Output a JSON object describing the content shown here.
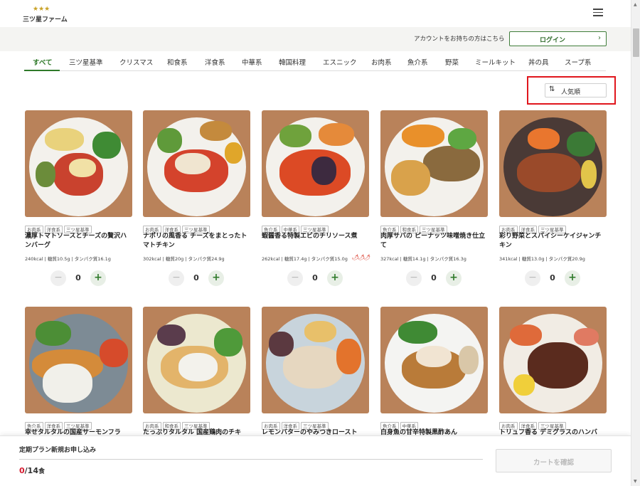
{
  "header": {
    "brand_stars": "★★★",
    "brand_name": "三ツ星ファーム",
    "account_prompt": "アカウントをお持ちの方はこちら",
    "login_label": "ログイン",
    "login_chevron": "›"
  },
  "tabs": [
    {
      "label": "すべて"
    },
    {
      "label": "三ツ星基準"
    },
    {
      "label": "クリスマス"
    },
    {
      "label": "和食系"
    },
    {
      "label": "洋食系"
    },
    {
      "label": "中華系"
    },
    {
      "label": "韓国料理"
    },
    {
      "label": "エスニック"
    },
    {
      "label": "お肉系"
    },
    {
      "label": "魚介系"
    },
    {
      "label": "野菜"
    },
    {
      "label": "ミールキット"
    },
    {
      "label": "丼の具"
    },
    {
      "label": "スープ系"
    }
  ],
  "sort": {
    "icon": "⇅",
    "label": "人気順"
  },
  "products": [
    {
      "tags": [
        "お肉系",
        "洋食系",
        "三ツ星基準"
      ],
      "title": "濃厚トマトソースとチーズの贅沢ハンバーグ",
      "nutrition": "240kcal | 糖質10.5g | タンパク質16.1g",
      "qty": "0",
      "spicy": ""
    },
    {
      "tags": [
        "お肉系",
        "洋食系",
        "三ツ星基準"
      ],
      "title": "ナポリの風香る チーズをまとったトマトチキン",
      "nutrition": "302kcal | 糖質20g | タンパク質24.9g",
      "qty": "0",
      "spicy": ""
    },
    {
      "tags": [
        "魚介系",
        "中華系",
        "三ツ星基準"
      ],
      "title": "蝦醤香る特製エビのチリソース煮",
      "nutrition": "262kcal | 糖質17.4g | タンパク質15.0g",
      "qty": "0",
      "spicy": "🌶🌶🌶"
    },
    {
      "tags": [
        "魚介系",
        "和食系",
        "三ツ星基準"
      ],
      "title": "肉厚サバの ピーナッツ味噌焼き仕立て",
      "nutrition": "327kcal | 糖質14.1g | タンパク質16.3g",
      "qty": "0",
      "spicy": ""
    },
    {
      "tags": [
        "お肉系",
        "洋食系",
        "三ツ星基準"
      ],
      "title": "彩り野菜とスパイシーケイジャンチキン",
      "nutrition": "341kcal | 糖質13.0g | タンパク質20.9g",
      "qty": "0",
      "spicy": ""
    },
    {
      "tags": [
        "魚介系",
        "洋食系",
        "三ツ星基準"
      ],
      "title": "幸せタルタルの国産サーモンフラ",
      "nutrition": "",
      "qty": "",
      "spicy": ""
    },
    {
      "tags": [
        "お肉系",
        "和食系",
        "三ツ星基準"
      ],
      "title": "たっぷりタルタル 国産鶏肉のチキ",
      "nutrition": "",
      "qty": "",
      "spicy": ""
    },
    {
      "tags": [
        "お肉系",
        "洋食系",
        "三ツ星基準"
      ],
      "title": "レモンバターのやみつきロースト",
      "nutrition": "",
      "qty": "",
      "spicy": ""
    },
    {
      "tags": [
        "魚介系",
        "中華系"
      ],
      "title": "白身魚の甘辛特製黒酢あん",
      "nutrition": "",
      "qty": "",
      "spicy": ""
    },
    {
      "tags": [
        "お肉系",
        "洋食系",
        "三ツ星基準"
      ],
      "title": "トリュフ香る デミグラスのハンバ",
      "nutrition": "",
      "qty": "",
      "spicy": ""
    }
  ],
  "stepper": {
    "minus": "−",
    "plus": "+"
  },
  "bottom_bar": {
    "plan_label": "定期プラン新規お申し込み",
    "count_current": "0",
    "count_rest": "/14",
    "count_unit": "食",
    "cart_label": "カートを確認"
  },
  "colors": {
    "accent_green": "#2f7a2a",
    "highlight_red": "#e0161d",
    "count_red": "#d4192f"
  }
}
